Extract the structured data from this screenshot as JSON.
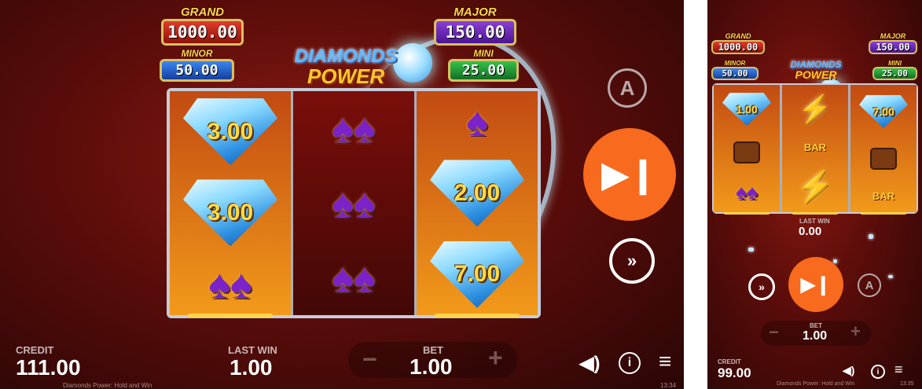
{
  "game": {
    "logo_line1": "DIAMONDS",
    "logo_line2": "POWER",
    "footer_name": "Diamonds Power: Hold and Win"
  },
  "landscape": {
    "jackpots": {
      "grand": {
        "label": "GRAND",
        "value": "1000.00"
      },
      "major": {
        "label": "MAJOR",
        "value": "150.00"
      },
      "minor": {
        "label": "MINOR",
        "value": "50.00"
      },
      "mini": {
        "label": "MINI",
        "value": "25.00"
      }
    },
    "reels": [
      [
        "3.00",
        "3.00",
        "spade-pair"
      ],
      [
        "spade-pair",
        "spade-pair",
        "spade-pair"
      ],
      [
        "spade",
        "2.00",
        "7.00"
      ]
    ],
    "credit_label": "CREDIT",
    "credit_value": "111.00",
    "last_win_label": "LAST WIN",
    "last_win_value": "1.00",
    "bet_label": "BET",
    "bet_value": "1.00",
    "clock": "13:34"
  },
  "portrait": {
    "jackpots": {
      "grand": {
        "label": "GRAND",
        "value": "1000.00"
      },
      "major": {
        "label": "MAJOR",
        "value": "150.00"
      },
      "minor": {
        "label": "MINOR",
        "value": "50.00"
      },
      "mini": {
        "label": "MINI",
        "value": "25.00"
      }
    },
    "diamond_values": [
      "1.00",
      "7.00"
    ],
    "bar_text": "BAR",
    "last_win_label": "LAST WIN",
    "last_win_value": "0.00",
    "bet_label": "BET",
    "bet_value": "1.00",
    "credit_label": "CREDIT",
    "credit_value": "99.00",
    "clock": "13:35"
  },
  "icons": {
    "play": "skip-forward-icon",
    "turbo": "turbo-chevrons-icon",
    "autoplay": "autoplay-icon",
    "sound": "speaker-icon",
    "info": "info-icon",
    "menu": "menu-icon"
  },
  "colors": {
    "accent": "#f86a1e",
    "background": "#5c0d0a",
    "gold": "#ffd64a"
  }
}
